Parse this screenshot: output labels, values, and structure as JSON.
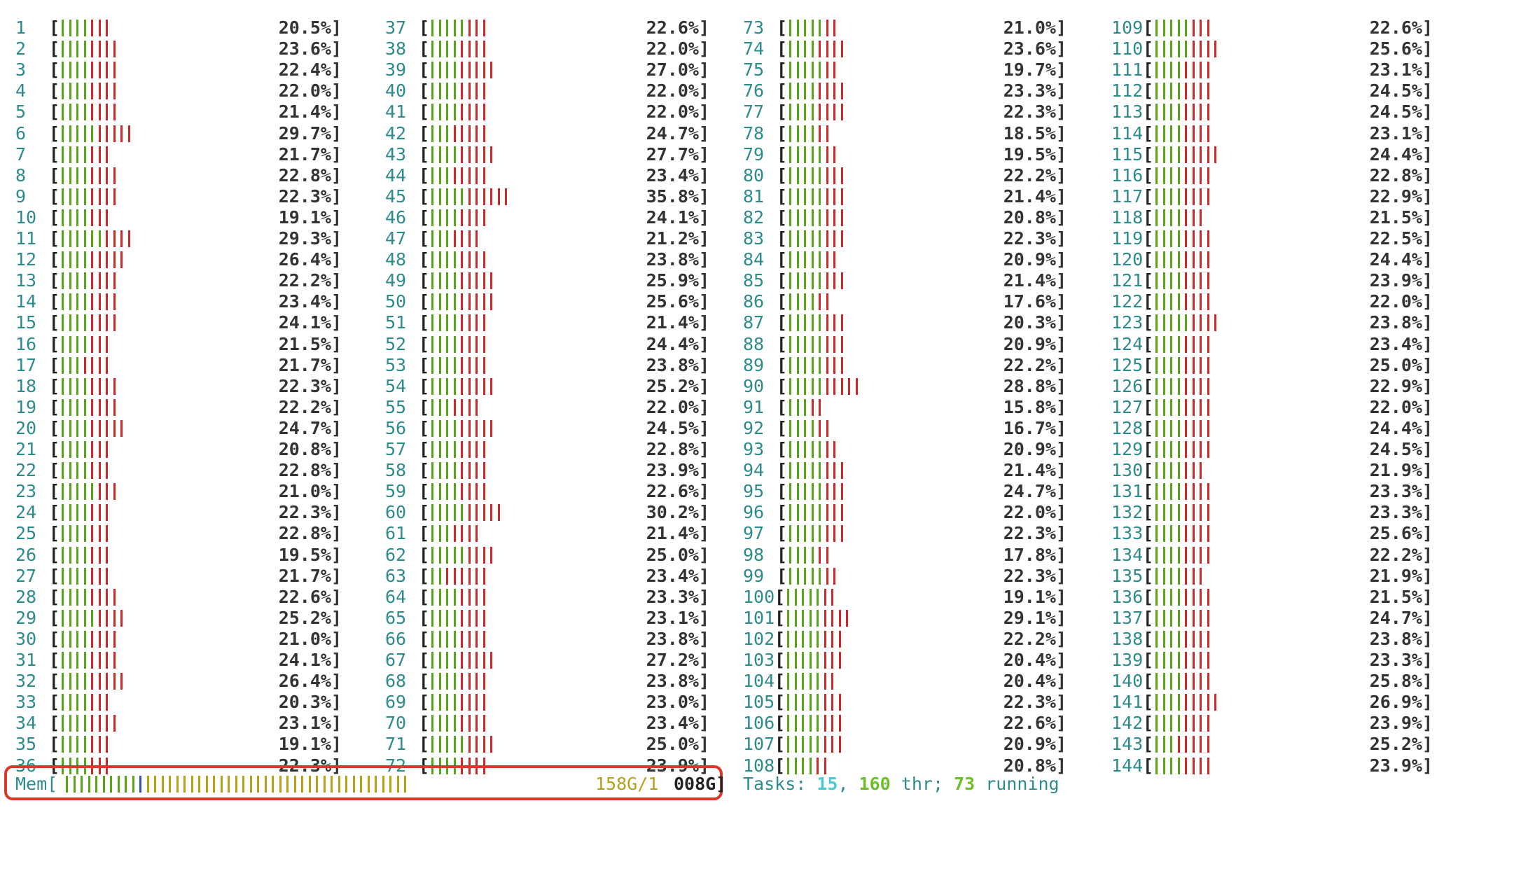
{
  "colors": {
    "label": "#2e8b8b",
    "bracket": "#222222",
    "low": "#58a618",
    "high": "#cc2a2a",
    "mem_used": "#b8a018",
    "highlight": "#d63a2a"
  },
  "cpus": [
    {
      "id": "1",
      "pct": "20.5%]",
      "g": 4,
      "r": 3
    },
    {
      "id": "2",
      "pct": "23.6%]",
      "g": 4,
      "r": 4
    },
    {
      "id": "3",
      "pct": "22.4%]",
      "g": 4,
      "r": 4
    },
    {
      "id": "4",
      "pct": "22.0%]",
      "g": 4,
      "r": 4
    },
    {
      "id": "5",
      "pct": "21.4%]",
      "g": 4,
      "r": 4
    },
    {
      "id": "6",
      "pct": "29.7%]",
      "g": 5,
      "r": 5
    },
    {
      "id": "7",
      "pct": "21.7%]",
      "g": 4,
      "r": 3
    },
    {
      "id": "8",
      "pct": "22.8%]",
      "g": 4,
      "r": 4
    },
    {
      "id": "9",
      "pct": "22.3%]",
      "g": 4,
      "r": 4
    },
    {
      "id": "10",
      "pct": "19.1%]",
      "g": 4,
      "r": 3
    },
    {
      "id": "11",
      "pct": "29.3%]",
      "g": 6,
      "r": 4
    },
    {
      "id": "12",
      "pct": "26.4%]",
      "g": 4,
      "r": 5
    },
    {
      "id": "13",
      "pct": "22.2%]",
      "g": 4,
      "r": 4
    },
    {
      "id": "14",
      "pct": "23.4%]",
      "g": 4,
      "r": 4
    },
    {
      "id": "15",
      "pct": "24.1%]",
      "g": 4,
      "r": 4
    },
    {
      "id": "16",
      "pct": "21.5%]",
      "g": 4,
      "r": 3
    },
    {
      "id": "17",
      "pct": "21.7%]",
      "g": 3,
      "r": 4
    },
    {
      "id": "18",
      "pct": "22.3%]",
      "g": 4,
      "r": 4
    },
    {
      "id": "19",
      "pct": "22.2%]",
      "g": 4,
      "r": 4
    },
    {
      "id": "20",
      "pct": "24.7%]",
      "g": 4,
      "r": 5
    },
    {
      "id": "21",
      "pct": "20.8%]",
      "g": 4,
      "r": 3
    },
    {
      "id": "22",
      "pct": "22.8%]",
      "g": 4,
      "r": 3
    },
    {
      "id": "23",
      "pct": "21.0%]",
      "g": 5,
      "r": 3
    },
    {
      "id": "24",
      "pct": "22.3%]",
      "g": 4,
      "r": 3
    },
    {
      "id": "25",
      "pct": "22.8%]",
      "g": 4,
      "r": 3
    },
    {
      "id": "26",
      "pct": "19.5%]",
      "g": 4,
      "r": 3
    },
    {
      "id": "27",
      "pct": "21.7%]",
      "g": 4,
      "r": 3
    },
    {
      "id": "28",
      "pct": "22.6%]",
      "g": 4,
      "r": 4
    },
    {
      "id": "29",
      "pct": "25.2%]",
      "g": 5,
      "r": 4
    },
    {
      "id": "30",
      "pct": "21.0%]",
      "g": 4,
      "r": 4
    },
    {
      "id": "31",
      "pct": "24.1%]",
      "g": 4,
      "r": 4
    },
    {
      "id": "32",
      "pct": "26.4%]",
      "g": 4,
      "r": 5
    },
    {
      "id": "33",
      "pct": "20.3%]",
      "g": 4,
      "r": 3
    },
    {
      "id": "34",
      "pct": "23.1%]",
      "g": 4,
      "r": 4
    },
    {
      "id": "35",
      "pct": "19.1%]",
      "g": 4,
      "r": 3
    },
    {
      "id": "36",
      "pct": "22.3%]",
      "g": 4,
      "r": 3
    },
    {
      "id": "37",
      "pct": "22.6%]",
      "g": 5,
      "r": 3
    },
    {
      "id": "38",
      "pct": "22.0%]",
      "g": 4,
      "r": 4
    },
    {
      "id": "39",
      "pct": "27.0%]",
      "g": 4,
      "r": 5
    },
    {
      "id": "40",
      "pct": "22.0%]",
      "g": 4,
      "r": 4
    },
    {
      "id": "41",
      "pct": "22.0%]",
      "g": 4,
      "r": 4
    },
    {
      "id": "42",
      "pct": "24.7%]",
      "g": 3,
      "r": 5
    },
    {
      "id": "43",
      "pct": "27.7%]",
      "g": 4,
      "r": 5
    },
    {
      "id": "44",
      "pct": "23.4%]",
      "g": 3,
      "r": 5
    },
    {
      "id": "45",
      "pct": "35.8%]",
      "g": 5,
      "r": 6
    },
    {
      "id": "46",
      "pct": "24.1%]",
      "g": 4,
      "r": 4
    },
    {
      "id": "47",
      "pct": "21.2%]",
      "g": 3,
      "r": 4
    },
    {
      "id": "48",
      "pct": "23.8%]",
      "g": 4,
      "r": 4
    },
    {
      "id": "49",
      "pct": "25.9%]",
      "g": 4,
      "r": 5
    },
    {
      "id": "50",
      "pct": "25.6%]",
      "g": 4,
      "r": 5
    },
    {
      "id": "51",
      "pct": "21.4%]",
      "g": 4,
      "r": 4
    },
    {
      "id": "52",
      "pct": "24.4%]",
      "g": 4,
      "r": 4
    },
    {
      "id": "53",
      "pct": "23.8%]",
      "g": 4,
      "r": 4
    },
    {
      "id": "54",
      "pct": "25.2%]",
      "g": 4,
      "r": 5
    },
    {
      "id": "55",
      "pct": "22.0%]",
      "g": 3,
      "r": 4
    },
    {
      "id": "56",
      "pct": "24.5%]",
      "g": 4,
      "r": 5
    },
    {
      "id": "57",
      "pct": "22.8%]",
      "g": 4,
      "r": 4
    },
    {
      "id": "58",
      "pct": "23.9%]",
      "g": 4,
      "r": 4
    },
    {
      "id": "59",
      "pct": "22.6%]",
      "g": 4,
      "r": 4
    },
    {
      "id": "60",
      "pct": "30.2%]",
      "g": 5,
      "r": 5
    },
    {
      "id": "61",
      "pct": "21.4%]",
      "g": 3,
      "r": 4
    },
    {
      "id": "62",
      "pct": "25.0%]",
      "g": 5,
      "r": 4
    },
    {
      "id": "63",
      "pct": "23.4%]",
      "g": 2,
      "r": 6
    },
    {
      "id": "64",
      "pct": "23.3%]",
      "g": 4,
      "r": 4
    },
    {
      "id": "65",
      "pct": "23.1%]",
      "g": 4,
      "r": 4
    },
    {
      "id": "66",
      "pct": "23.8%]",
      "g": 4,
      "r": 4
    },
    {
      "id": "67",
      "pct": "27.2%]",
      "g": 4,
      "r": 5
    },
    {
      "id": "68",
      "pct": "23.8%]",
      "g": 4,
      "r": 4
    },
    {
      "id": "69",
      "pct": "23.0%]",
      "g": 4,
      "r": 4
    },
    {
      "id": "70",
      "pct": "23.4%]",
      "g": 4,
      "r": 4
    },
    {
      "id": "71",
      "pct": "25.0%]",
      "g": 5,
      "r": 4
    },
    {
      "id": "72",
      "pct": "23.9%]",
      "g": 4,
      "r": 4
    },
    {
      "id": "73",
      "pct": "21.0%]",
      "g": 5,
      "r": 2
    },
    {
      "id": "74",
      "pct": "23.6%]",
      "g": 4,
      "r": 4
    },
    {
      "id": "75",
      "pct": "19.7%]",
      "g": 5,
      "r": 2
    },
    {
      "id": "76",
      "pct": "23.3%]",
      "g": 4,
      "r": 4
    },
    {
      "id": "77",
      "pct": "22.3%]",
      "g": 4,
      "r": 4
    },
    {
      "id": "78",
      "pct": "18.5%]",
      "g": 4,
      "r": 2
    },
    {
      "id": "79",
      "pct": "19.5%]",
      "g": 5,
      "r": 2
    },
    {
      "id": "80",
      "pct": "22.2%]",
      "g": 5,
      "r": 3
    },
    {
      "id": "81",
      "pct": "21.4%]",
      "g": 5,
      "r": 3
    },
    {
      "id": "82",
      "pct": "20.8%]",
      "g": 5,
      "r": 3
    },
    {
      "id": "83",
      "pct": "22.3%]",
      "g": 5,
      "r": 3
    },
    {
      "id": "84",
      "pct": "20.9%]",
      "g": 5,
      "r": 2
    },
    {
      "id": "85",
      "pct": "21.4%]",
      "g": 5,
      "r": 3
    },
    {
      "id": "86",
      "pct": "17.6%]",
      "g": 4,
      "r": 2
    },
    {
      "id": "87",
      "pct": "20.3%]",
      "g": 5,
      "r": 3
    },
    {
      "id": "88",
      "pct": "20.9%]",
      "g": 5,
      "r": 3
    },
    {
      "id": "89",
      "pct": "22.2%]",
      "g": 5,
      "r": 3
    },
    {
      "id": "90",
      "pct": "28.8%]",
      "g": 5,
      "r": 5
    },
    {
      "id": "91",
      "pct": "15.8%]",
      "g": 3,
      "r": 2
    },
    {
      "id": "92",
      "pct": "16.7%]",
      "g": 4,
      "r": 2
    },
    {
      "id": "93",
      "pct": "20.9%]",
      "g": 5,
      "r": 2
    },
    {
      "id": "94",
      "pct": "21.4%]",
      "g": 5,
      "r": 3
    },
    {
      "id": "95",
      "pct": "24.7%]",
      "g": 5,
      "r": 3
    },
    {
      "id": "96",
      "pct": "22.0%]",
      "g": 5,
      "r": 3
    },
    {
      "id": "97",
      "pct": "22.3%]",
      "g": 5,
      "r": 3
    },
    {
      "id": "98",
      "pct": "17.8%]",
      "g": 4,
      "r": 2
    },
    {
      "id": "99",
      "pct": "22.3%]",
      "g": 5,
      "r": 2
    },
    {
      "id": "100",
      "pct": "19.1%]",
      "g": 5,
      "r": 2
    },
    {
      "id": "101",
      "pct": "29.1%]",
      "g": 5,
      "r": 4
    },
    {
      "id": "102",
      "pct": "22.2%]",
      "g": 5,
      "r": 3
    },
    {
      "id": "103",
      "pct": "20.4%]",
      "g": 5,
      "r": 3
    },
    {
      "id": "104",
      "pct": "20.4%]",
      "g": 5,
      "r": 2
    },
    {
      "id": "105",
      "pct": "22.3%]",
      "g": 5,
      "r": 3
    },
    {
      "id": "106",
      "pct": "22.6%]",
      "g": 5,
      "r": 3
    },
    {
      "id": "107",
      "pct": "20.9%]",
      "g": 5,
      "r": 3
    },
    {
      "id": "108",
      "pct": "20.8%]",
      "g": 4,
      "r": 2
    },
    {
      "id": "109",
      "pct": "22.6%]",
      "g": 5,
      "r": 3
    },
    {
      "id": "110",
      "pct": "25.6%]",
      "g": 5,
      "r": 4
    },
    {
      "id": "111",
      "pct": "23.1%]",
      "g": 4,
      "r": 4
    },
    {
      "id": "112",
      "pct": "24.5%]",
      "g": 4,
      "r": 4
    },
    {
      "id": "113",
      "pct": "24.5%]",
      "g": 4,
      "r": 4
    },
    {
      "id": "114",
      "pct": "23.1%]",
      "g": 4,
      "r": 4
    },
    {
      "id": "115",
      "pct": "24.4%]",
      "g": 4,
      "r": 5
    },
    {
      "id": "116",
      "pct": "22.8%]",
      "g": 4,
      "r": 4
    },
    {
      "id": "117",
      "pct": "22.9%]",
      "g": 4,
      "r": 4
    },
    {
      "id": "118",
      "pct": "21.5%]",
      "g": 4,
      "r": 3
    },
    {
      "id": "119",
      "pct": "22.5%]",
      "g": 4,
      "r": 4
    },
    {
      "id": "120",
      "pct": "24.4%]",
      "g": 4,
      "r": 4
    },
    {
      "id": "121",
      "pct": "23.9%]",
      "g": 4,
      "r": 4
    },
    {
      "id": "122",
      "pct": "22.0%]",
      "g": 4,
      "r": 4
    },
    {
      "id": "123",
      "pct": "23.8%]",
      "g": 5,
      "r": 4
    },
    {
      "id": "124",
      "pct": "23.4%]",
      "g": 4,
      "r": 4
    },
    {
      "id": "125",
      "pct": "25.0%]",
      "g": 4,
      "r": 4
    },
    {
      "id": "126",
      "pct": "22.9%]",
      "g": 4,
      "r": 4
    },
    {
      "id": "127",
      "pct": "22.0%]",
      "g": 4,
      "r": 4
    },
    {
      "id": "128",
      "pct": "24.4%]",
      "g": 4,
      "r": 4
    },
    {
      "id": "129",
      "pct": "24.5%]",
      "g": 4,
      "r": 4
    },
    {
      "id": "130",
      "pct": "21.9%]",
      "g": 4,
      "r": 3
    },
    {
      "id": "131",
      "pct": "23.3%]",
      "g": 4,
      "r": 4
    },
    {
      "id": "132",
      "pct": "23.3%]",
      "g": 4,
      "r": 4
    },
    {
      "id": "133",
      "pct": "25.6%]",
      "g": 4,
      "r": 4
    },
    {
      "id": "134",
      "pct": "22.2%]",
      "g": 4,
      "r": 4
    },
    {
      "id": "135",
      "pct": "21.9%]",
      "g": 4,
      "r": 3
    },
    {
      "id": "136",
      "pct": "21.5%]",
      "g": 4,
      "r": 4
    },
    {
      "id": "137",
      "pct": "24.7%]",
      "g": 4,
      "r": 4
    },
    {
      "id": "138",
      "pct": "23.8%]",
      "g": 4,
      "r": 4
    },
    {
      "id": "139",
      "pct": "23.3%]",
      "g": 4,
      "r": 4
    },
    {
      "id": "140",
      "pct": "25.8%]",
      "g": 4,
      "r": 4
    },
    {
      "id": "141",
      "pct": "26.9%]",
      "g": 4,
      "r": 5
    },
    {
      "id": "142",
      "pct": "23.9%]",
      "g": 4,
      "r": 4
    },
    {
      "id": "143",
      "pct": "25.2%]",
      "g": 3,
      "r": 5
    },
    {
      "id": "144",
      "pct": "23.9%]",
      "g": 4,
      "r": 4
    }
  ],
  "memory": {
    "label": "Mem[",
    "used": "158G/1",
    "total": "008G]",
    "bars": {
      "green": 10,
      "blue": 1,
      "yellow": 36
    }
  },
  "tasks": {
    "label": "Tasks: ",
    "count": "15",
    "sep1": ", ",
    "threads": "160",
    "thr_label": " thr; ",
    "running": "73",
    "running_label": " running"
  }
}
